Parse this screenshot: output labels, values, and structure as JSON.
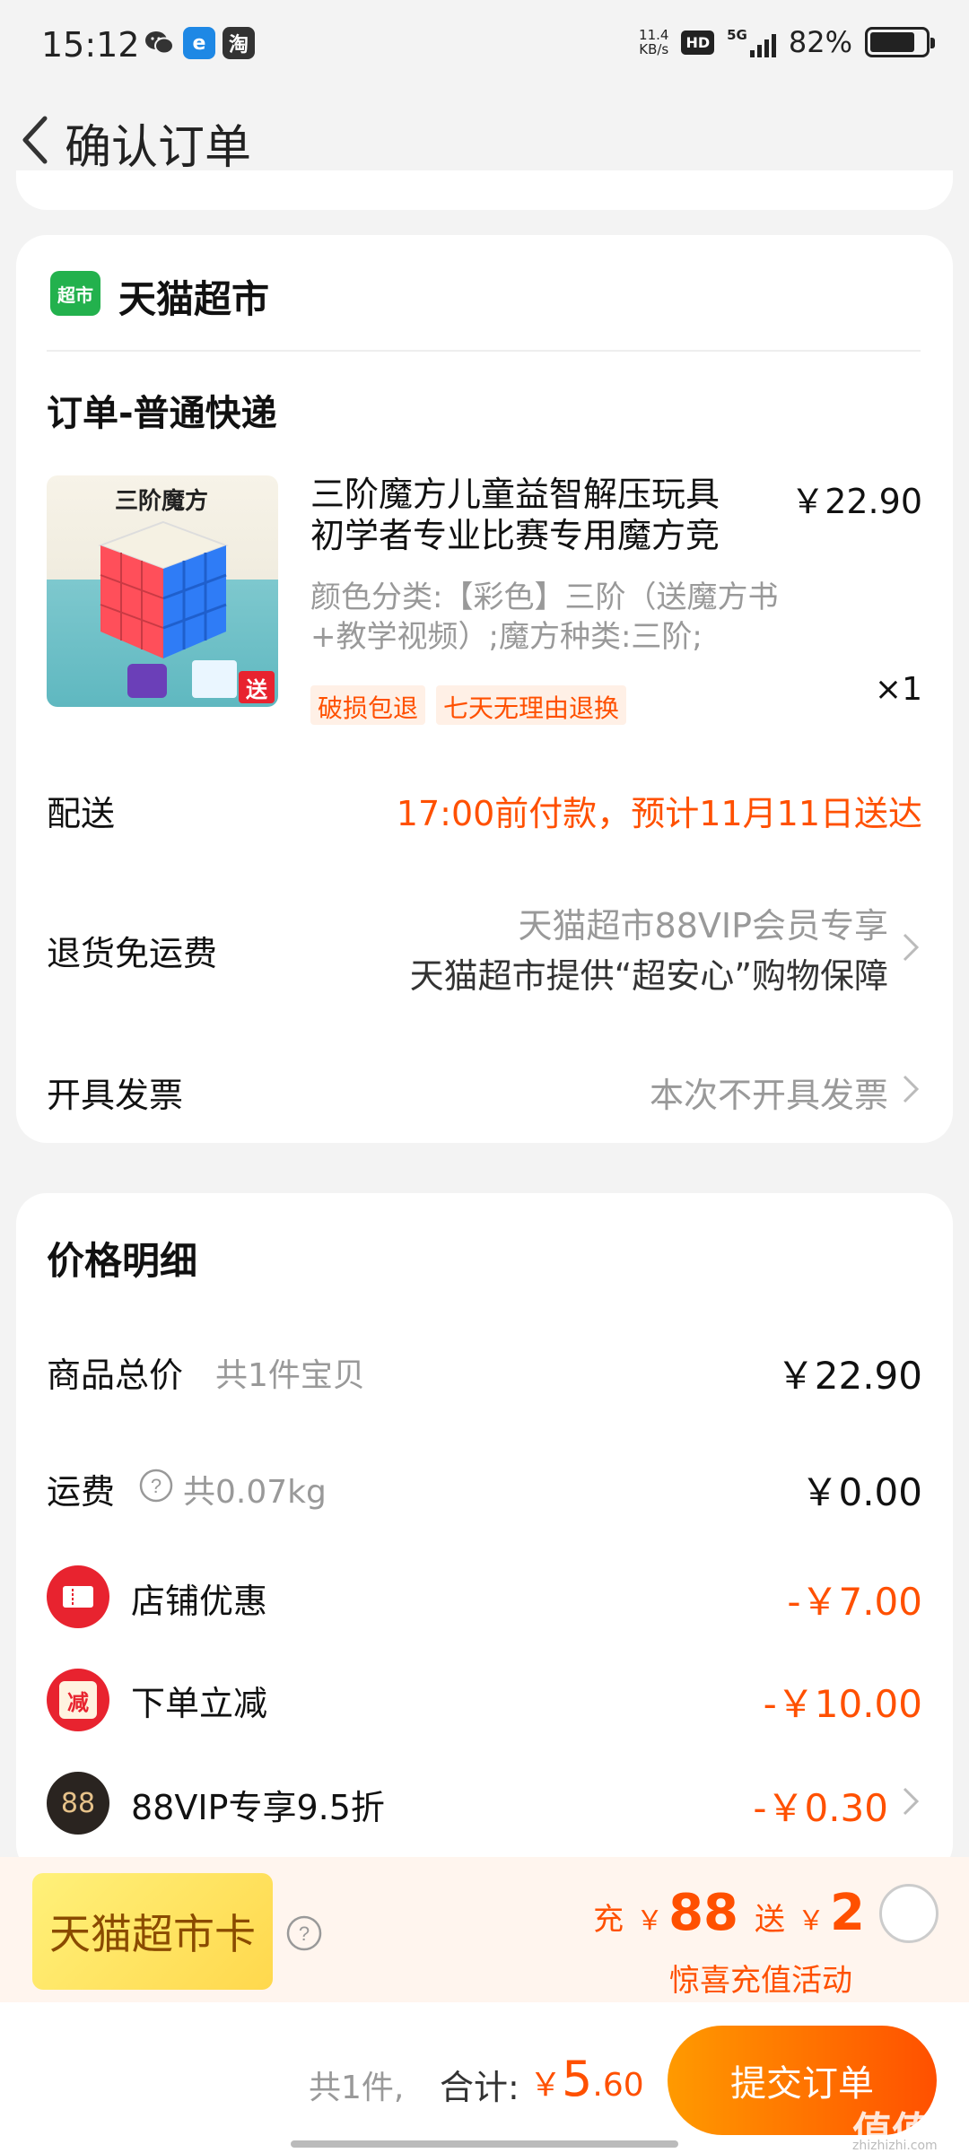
{
  "status_bar": {
    "time": "15:12",
    "apps": [
      "wechat-icon",
      "browser-icon",
      "taobao-icon"
    ],
    "taobao_label": "淘",
    "net_speed_value": "11.4",
    "net_speed_unit": "KB/s",
    "hd": "HD",
    "network": "5G",
    "battery": "82%",
    "battery_level": 0.82
  },
  "header": {
    "title": "确认订单"
  },
  "store": {
    "logo_text": "超市",
    "name": "天猫超市"
  },
  "order": {
    "section_title": "订单-普通快递",
    "product": {
      "image_title": "三阶魔方",
      "image_badge": "送",
      "title": "三阶魔方儿童益智解压玩具初学者专业比赛专用魔方竞速…",
      "price": "￥22.90",
      "spec": "颜色分类:【彩色】三阶（送魔方书+教学视频）;魔方种类:三阶;",
      "tags": [
        "破损包退",
        "七天无理由退换"
      ],
      "quantity": "×1"
    },
    "delivery": {
      "label": "配送",
      "value": "17:00前付款，预计11月11日送达"
    },
    "return_shipping": {
      "label": "退货免运费",
      "line1": "天猫超市88VIP会员专享",
      "line2": "天猫超市提供“超安心”购物保障"
    },
    "invoice": {
      "label": "开具发票",
      "value": "本次不开具发票"
    }
  },
  "price_detail": {
    "title": "价格明细",
    "goods_total": {
      "label": "商品总价",
      "sub": "共1件宝贝",
      "value": "￥22.90"
    },
    "shipping": {
      "label": "运费",
      "sub": "共0.07kg",
      "value": "￥0.00"
    },
    "discounts": [
      {
        "label": "店铺优惠",
        "value": "-￥7.00",
        "icon": "coupon-icon"
      },
      {
        "label": "下单立减",
        "value": "-￥10.00",
        "icon": "reduce-icon",
        "icon_text": "减"
      },
      {
        "label": "88VIP专享9.5折",
        "value": "-￥0.30",
        "icon": "vip88-icon",
        "icon_text": "88"
      }
    ]
  },
  "promo": {
    "card_label": "天猫超市卡",
    "charge_label": "充",
    "charge_amount": "88",
    "gift_label": "送",
    "gift_amount": "2",
    "currency": "￥",
    "subtitle": "惊喜充值活动"
  },
  "footer": {
    "count": "共1件,",
    "total_label": "合计:",
    "currency": "￥",
    "total_int": "5",
    "total_dec": ".60",
    "submit_label": "提交订单"
  },
  "watermark": {
    "mark": "值值值",
    "site": "zhizhizhi.com"
  },
  "colors": {
    "accent": "#ff5000",
    "tmall_green": "#23b14d",
    "bg": "#f3f3f3"
  }
}
